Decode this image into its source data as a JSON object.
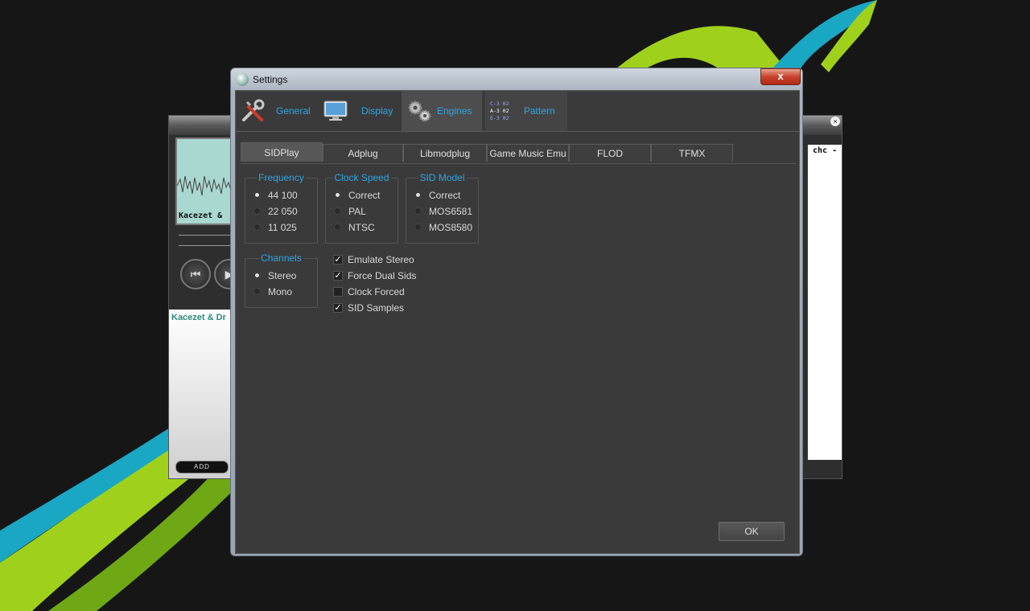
{
  "player": {
    "track_text": "Kacezet &",
    "list_entry": "Kacezet & Dr",
    "add_label": "ADD",
    "right_text": "chc -",
    "prev_icon": "⏮",
    "next_icon": "▶"
  },
  "window": {
    "title": "Settings",
    "close_glyph": "x"
  },
  "toolbar": [
    {
      "label": "General",
      "icon": "tools-icon"
    },
    {
      "label": "Display",
      "icon": "monitor-icon"
    },
    {
      "label": "Engines",
      "icon": "gears-icon",
      "active": true
    },
    {
      "label": "Pattern",
      "icon": "pattern-icon"
    }
  ],
  "pattern_icon_lines": [
    "C-3 02",
    "A-3 02",
    "E-3 02"
  ],
  "tabs": [
    "SIDPlay",
    "Adplug",
    "Libmodplug",
    "Game Music Emu",
    "FLOD",
    "TFMX"
  ],
  "active_tab": "SIDPlay",
  "frequency": {
    "label": "Frequency",
    "options": [
      "44 100",
      "22 050",
      "11 025"
    ],
    "selected": "44 100"
  },
  "clock_speed": {
    "label": "Clock Speed",
    "options": [
      "Correct",
      "PAL",
      "NTSC"
    ],
    "selected": "Correct"
  },
  "sid_model": {
    "label": "SID Model",
    "options": [
      "Correct",
      "MOS6581",
      "MOS8580"
    ],
    "selected": "Correct"
  },
  "channels": {
    "label": "Channels",
    "options": [
      "Stereo",
      "Mono"
    ],
    "selected": "Stereo"
  },
  "checkboxes": [
    {
      "label": "Emulate Stereo",
      "checked": true
    },
    {
      "label": "Force Dual Sids",
      "checked": true
    },
    {
      "label": "Clock Forced",
      "checked": false
    },
    {
      "label": "SID Samples",
      "checked": true
    }
  ],
  "ok_label": "OK",
  "colors": {
    "accent": "#2ea6e6",
    "panel": "#3a3a3a",
    "close": "#c7412b"
  }
}
